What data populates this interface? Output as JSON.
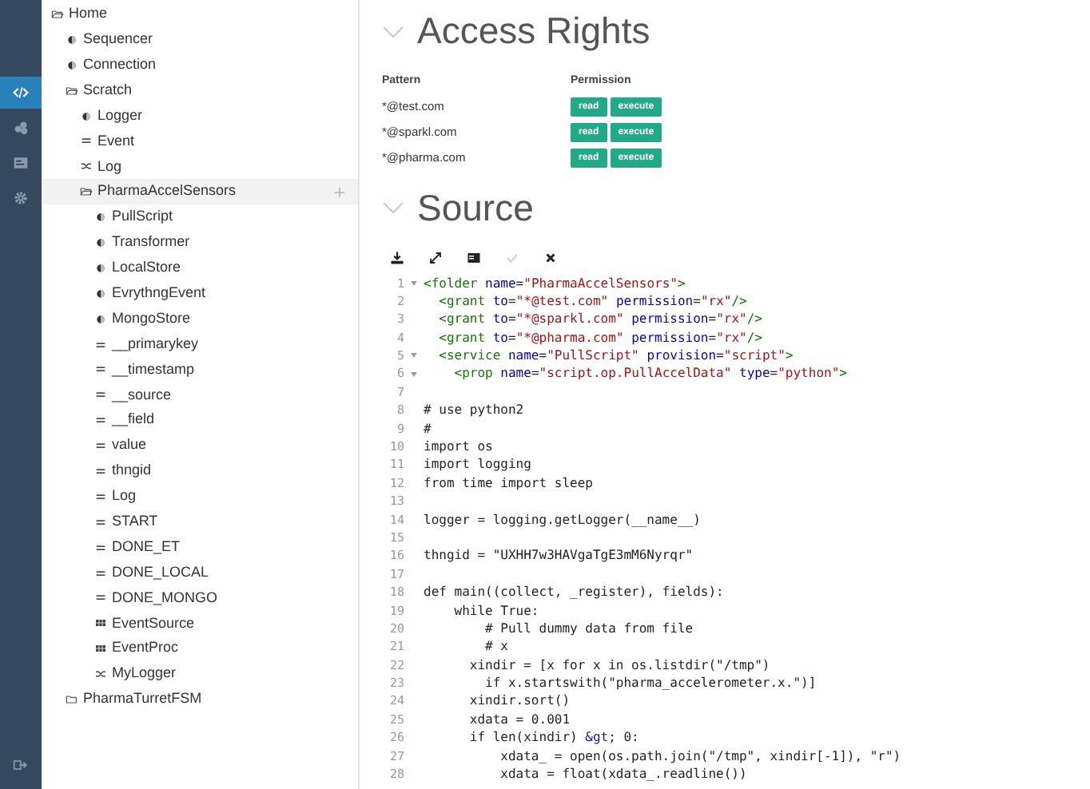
{
  "rail": {
    "items": [
      {
        "kind": "code",
        "selected": true
      },
      {
        "kind": "share",
        "selected": false
      },
      {
        "kind": "card",
        "selected": false
      },
      {
        "kind": "gear",
        "selected": false
      }
    ],
    "bottom": {
      "kind": "logout"
    }
  },
  "tree": [
    {
      "label": "Home",
      "kind": "folder",
      "expanded": true,
      "selected": false,
      "children": [
        {
          "label": "Sequencer",
          "kind": "service",
          "selected": false
        },
        {
          "label": "Connection",
          "kind": "service",
          "selected": false
        },
        {
          "label": "Scratch",
          "kind": "folder",
          "expanded": true,
          "selected": false,
          "children": [
            {
              "label": "Logger",
              "kind": "service",
              "selected": false
            },
            {
              "label": "Event",
              "kind": "field",
              "selected": false
            },
            {
              "label": "Log",
              "kind": "mix",
              "selected": false
            },
            {
              "label": "PharmaAccelSensors",
              "kind": "folder",
              "expanded": true,
              "selected": true,
              "children": [
                {
                  "label": "PullScript",
                  "kind": "service",
                  "selected": false
                },
                {
                  "label": "Transformer",
                  "kind": "service",
                  "selected": false
                },
                {
                  "label": "LocalStore",
                  "kind": "service",
                  "selected": false
                },
                {
                  "label": "EvrythngEvent",
                  "kind": "service",
                  "selected": false
                },
                {
                  "label": "MongoStore",
                  "kind": "service",
                  "selected": false
                },
                {
                  "label": "__primarykey",
                  "kind": "field",
                  "selected": false
                },
                {
                  "label": "__timestamp",
                  "kind": "field",
                  "selected": false
                },
                {
                  "label": "__source",
                  "kind": "field",
                  "selected": false
                },
                {
                  "label": "__field",
                  "kind": "field",
                  "selected": false
                },
                {
                  "label": "value",
                  "kind": "field",
                  "selected": false
                },
                {
                  "label": "thngid",
                  "kind": "field",
                  "selected": false
                },
                {
                  "label": "Log",
                  "kind": "field",
                  "selected": false
                },
                {
                  "label": "START",
                  "kind": "field",
                  "selected": false
                },
                {
                  "label": "DONE_ET",
                  "kind": "field",
                  "selected": false
                },
                {
                  "label": "DONE_LOCAL",
                  "kind": "field",
                  "selected": false
                },
                {
                  "label": "DONE_MONGO",
                  "kind": "field",
                  "selected": false
                },
                {
                  "label": "EventSource",
                  "kind": "grid",
                  "selected": false
                },
                {
                  "label": "EventProc",
                  "kind": "grid",
                  "selected": false
                },
                {
                  "label": "MyLogger",
                  "kind": "mix",
                  "selected": false
                }
              ]
            }
          ]
        },
        {
          "label": "PharmaTurretFSM",
          "kind": "folder",
          "expanded": false,
          "selected": false
        }
      ]
    }
  ],
  "access_rights": {
    "title": "Access Rights",
    "expanded": true,
    "columns": [
      "Pattern",
      "Permission"
    ],
    "rows": [
      {
        "pattern": "*@test.com",
        "permissions": [
          "read",
          "execute"
        ]
      },
      {
        "pattern": "*@sparkl.com",
        "permissions": [
          "read",
          "execute"
        ]
      },
      {
        "pattern": "*@pharma.com",
        "permissions": [
          "read",
          "execute"
        ]
      }
    ]
  },
  "source": {
    "title": "Source",
    "expanded": true,
    "toolbar": [
      {
        "kind": "download",
        "disabled": false
      },
      {
        "kind": "expand",
        "disabled": false
      },
      {
        "kind": "console",
        "disabled": false
      },
      {
        "kind": "check",
        "disabled": true
      },
      {
        "kind": "close",
        "disabled": false
      }
    ],
    "lines": [
      {
        "number": "1",
        "fold": true,
        "tokens": [
          {
            "kind": "tag",
            "text": "<folder "
          },
          {
            "kind": "attr",
            "text": "name"
          },
          {
            "kind": "plain",
            "text": "="
          },
          {
            "kind": "string",
            "text": "\"PharmaAccelSensors\""
          },
          {
            "kind": "tag",
            "text": ">"
          }
        ]
      },
      {
        "number": "2",
        "fold": false,
        "tokens": [
          {
            "kind": "tag",
            "text": "  <grant "
          },
          {
            "kind": "attr",
            "text": "to"
          },
          {
            "kind": "plain",
            "text": "="
          },
          {
            "kind": "string",
            "text": "\"*@test.com\""
          },
          {
            "kind": "attr",
            "text": " permission"
          },
          {
            "kind": "plain",
            "text": "="
          },
          {
            "kind": "string",
            "text": "\"rx\""
          },
          {
            "kind": "tag",
            "text": "/>"
          }
        ]
      },
      {
        "number": "3",
        "fold": false,
        "tokens": [
          {
            "kind": "tag",
            "text": "  <grant "
          },
          {
            "kind": "attr",
            "text": "to"
          },
          {
            "kind": "plain",
            "text": "="
          },
          {
            "kind": "string",
            "text": "\"*@sparkl.com\""
          },
          {
            "kind": "attr",
            "text": " permission"
          },
          {
            "kind": "plain",
            "text": "="
          },
          {
            "kind": "string",
            "text": "\"rx\""
          },
          {
            "kind": "tag",
            "text": "/>"
          }
        ]
      },
      {
        "number": "4",
        "fold": false,
        "tokens": [
          {
            "kind": "tag",
            "text": "  <grant "
          },
          {
            "kind": "attr",
            "text": "to"
          },
          {
            "kind": "plain",
            "text": "="
          },
          {
            "kind": "string",
            "text": "\"*@pharma.com\""
          },
          {
            "kind": "attr",
            "text": " permission"
          },
          {
            "kind": "plain",
            "text": "="
          },
          {
            "kind": "string",
            "text": "\"rx\""
          },
          {
            "kind": "tag",
            "text": "/>"
          }
        ]
      },
      {
        "number": "5",
        "fold": true,
        "tokens": [
          {
            "kind": "tag",
            "text": "  <service "
          },
          {
            "kind": "attr",
            "text": "name"
          },
          {
            "kind": "plain",
            "text": "="
          },
          {
            "kind": "string",
            "text": "\"PullScript\""
          },
          {
            "kind": "attr",
            "text": " provision"
          },
          {
            "kind": "plain",
            "text": "="
          },
          {
            "kind": "string",
            "text": "\"script\""
          },
          {
            "kind": "tag",
            "text": ">"
          }
        ]
      },
      {
        "number": "6",
        "fold": true,
        "tokens": [
          {
            "kind": "tag",
            "text": "    <prop "
          },
          {
            "kind": "attr",
            "text": "name"
          },
          {
            "kind": "plain",
            "text": "="
          },
          {
            "kind": "string",
            "text": "\"script.op.PullAccelData\""
          },
          {
            "kind": "attr",
            "text": " type"
          },
          {
            "kind": "plain",
            "text": "="
          },
          {
            "kind": "string",
            "text": "\"python\""
          },
          {
            "kind": "tag",
            "text": ">"
          }
        ]
      },
      {
        "number": "7",
        "fold": false
      },
      {
        "number": "8",
        "fold": false,
        "tokens": [
          {
            "kind": "plain",
            "text": "# use python2"
          }
        ]
      },
      {
        "number": "9",
        "fold": false,
        "tokens": [
          {
            "kind": "plain",
            "text": "#"
          }
        ]
      },
      {
        "number": "10",
        "fold": false,
        "tokens": [
          {
            "kind": "plain",
            "text": "import os"
          }
        ]
      },
      {
        "number": "11",
        "fold": false,
        "tokens": [
          {
            "kind": "plain",
            "text": "import logging"
          }
        ]
      },
      {
        "number": "12",
        "fold": false,
        "tokens": [
          {
            "kind": "plain",
            "text": "from time import sleep"
          }
        ]
      },
      {
        "number": "13",
        "fold": false
      },
      {
        "number": "14",
        "fold": false,
        "tokens": [
          {
            "kind": "plain",
            "text": "logger = logging.getLogger(__name__)"
          }
        ]
      },
      {
        "number": "15",
        "fold": false
      },
      {
        "number": "16",
        "fold": false,
        "tokens": [
          {
            "kind": "plain",
            "text": "thngid = \"UXHH7w3HAVgaTgE3mM6Nyrqr\""
          }
        ]
      },
      {
        "number": "17",
        "fold": false
      },
      {
        "number": "18",
        "fold": false,
        "tokens": [
          {
            "kind": "plain",
            "text": "def main((collect, _register), fields):"
          }
        ]
      },
      {
        "number": "19",
        "fold": false,
        "tokens": [
          {
            "kind": "plain",
            "text": "    while True:"
          }
        ]
      },
      {
        "number": "20",
        "fold": false,
        "tokens": [
          {
            "kind": "plain",
            "text": "        # Pull dummy data from file"
          }
        ]
      },
      {
        "number": "21",
        "fold": false,
        "tokens": [
          {
            "kind": "plain",
            "text": "        # x"
          }
        ]
      },
      {
        "number": "22",
        "fold": false,
        "tokens": [
          {
            "kind": "plain",
            "text": "      xindir = [x for x in os.listdir(\"/tmp\")"
          }
        ]
      },
      {
        "number": "23",
        "fold": false,
        "tokens": [
          {
            "kind": "plain",
            "text": "        if x.startswith(\"pharma_accelerometer.x.\")]"
          }
        ]
      },
      {
        "number": "24",
        "fold": false,
        "tokens": [
          {
            "kind": "plain",
            "text": "      xindir.sort()"
          }
        ]
      },
      {
        "number": "25",
        "fold": false,
        "tokens": [
          {
            "kind": "plain",
            "text": "      xdata = 0.001"
          }
        ]
      },
      {
        "number": "26",
        "fold": false,
        "tokens": [
          {
            "kind": "plain",
            "text": "      if len(xindir) "
          },
          {
            "kind": "atom",
            "text": "&gt;"
          },
          {
            "kind": "plain",
            "text": " 0:"
          }
        ]
      },
      {
        "number": "27",
        "fold": false,
        "tokens": [
          {
            "kind": "plain",
            "text": "          xdata_ = open(os.path.join(\"/tmp\", xindir[-1]), \"r\")"
          }
        ]
      },
      {
        "number": "28",
        "fold": false,
        "tokens": [
          {
            "kind": "plain",
            "text": "          xdata = float(xdata_.readline())"
          }
        ]
      }
    ]
  }
}
